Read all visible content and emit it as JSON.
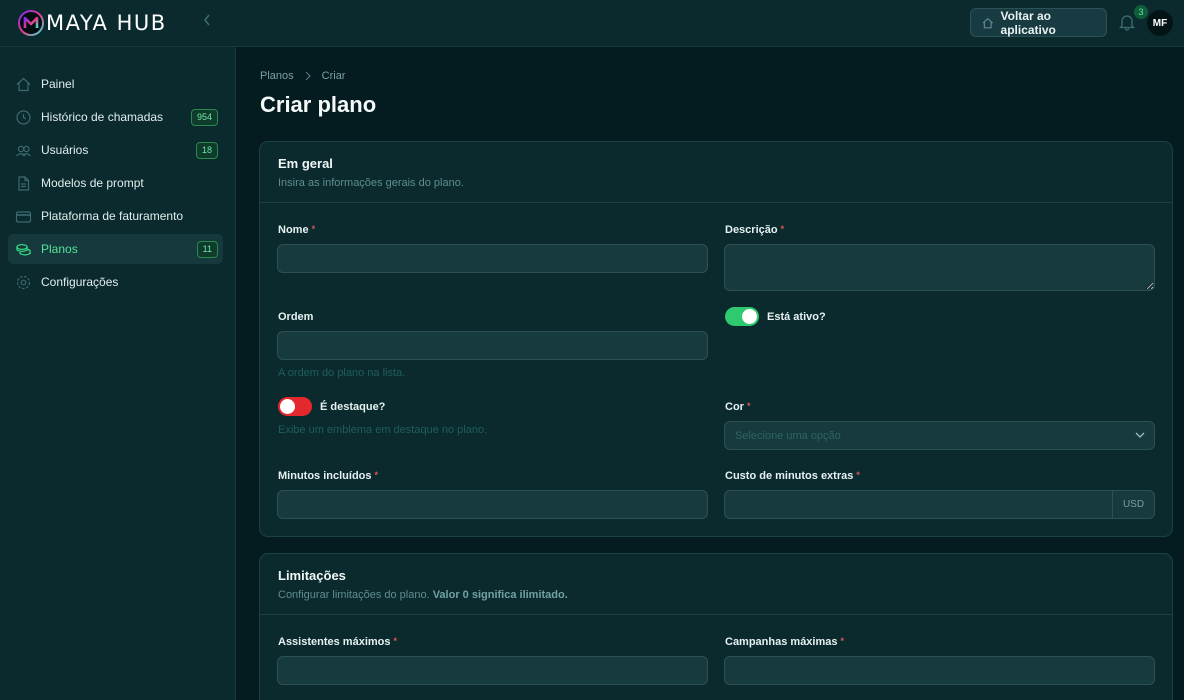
{
  "app": {
    "logo_text": "MAYA HUB"
  },
  "header": {
    "back_button": "Voltar ao aplicativo",
    "notifications_count": "3",
    "avatar_initials": "MF"
  },
  "sidebar": {
    "items": [
      {
        "label": "Painel",
        "icon": "home-icon"
      },
      {
        "label": "Histórico de chamadas",
        "icon": "history-icon",
        "badge": "954"
      },
      {
        "label": "Usuários",
        "icon": "users-icon",
        "badge": "18"
      },
      {
        "label": "Modelos de prompt",
        "icon": "document-icon"
      },
      {
        "label": "Plataforma de faturamento",
        "icon": "billing-icon"
      },
      {
        "label": "Planos",
        "icon": "coins-icon",
        "badge": "11",
        "active": true
      },
      {
        "label": "Configurações",
        "icon": "gear-icon"
      }
    ]
  },
  "breadcrumb": {
    "parent": "Planos",
    "current": "Criar"
  },
  "page": {
    "title": "Criar plano"
  },
  "general": {
    "title": "Em geral",
    "description": "Insira as informações gerais do plano.",
    "name_label": "Nome",
    "name_value": "",
    "description_label": "Descrição",
    "description_value": "",
    "order_label": "Ordem",
    "order_value": "",
    "order_hint": "A ordem do plano na lista.",
    "active_label": "Está ativo?",
    "active_on": true,
    "featured_label": "É destaque?",
    "featured_on": false,
    "featured_hint": "Exibe um emblema em destaque no plano.",
    "color_label": "Cor",
    "color_placeholder": "Selecione uma opção",
    "minutes_label": "Minutos incluídos",
    "minutes_value": "",
    "extra_cost_label": "Custo de minutos extras",
    "extra_cost_value": "",
    "extra_cost_suffix": "USD"
  },
  "limits": {
    "title": "Limitações",
    "description": "Configurar limitações do plano.",
    "description_strong": "Valor 0 significa ilimitado.",
    "max_assistants_label": "Assistentes máximos",
    "max_assistants_value": "",
    "max_campaigns_label": "Campanhas máximas",
    "max_campaigns_value": ""
  },
  "colors": {
    "accent": "#2fc96f",
    "toggle_off": "#e5282e",
    "background": "#041c20",
    "panel": "#0b2a2e"
  }
}
